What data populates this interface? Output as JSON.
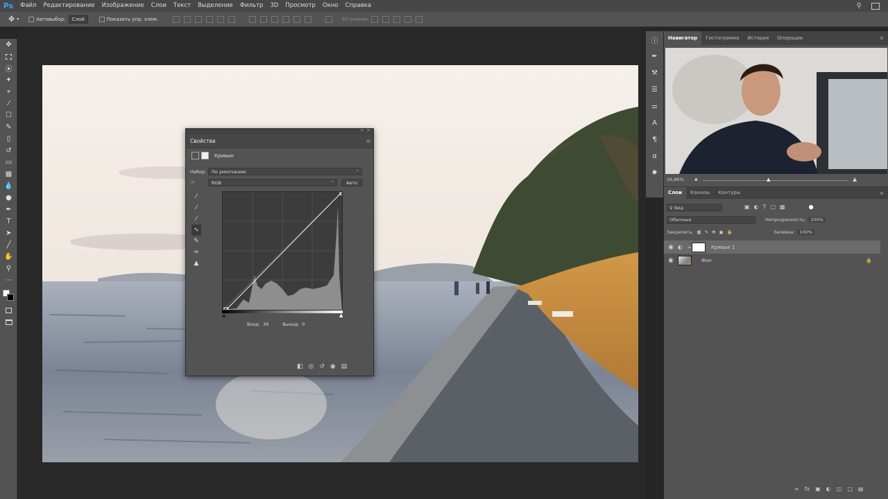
{
  "app": {
    "logo": "Ps"
  },
  "menu": [
    "Файл",
    "Редактирование",
    "Изображение",
    "Слои",
    "Текст",
    "Выделение",
    "Фильтр",
    "3D",
    "Просмотр",
    "Окно",
    "Справка"
  ],
  "options": {
    "autoselect_label": "Автовыбор:",
    "autoselect_value": "Слой",
    "show_transform_label": "Показать упр. элем.",
    "mode3d_label": "3D-режим:"
  },
  "tools": [
    "move-icon",
    "marquee-icon",
    "lasso-icon",
    "quick-select-icon",
    "crop-icon",
    "eyedropper-icon",
    "healing-icon",
    "brush-icon",
    "stamp-icon",
    "history-brush-icon",
    "eraser-icon",
    "gradient-icon",
    "blur-icon",
    "dodge-icon",
    "pen-icon",
    "type-icon",
    "path-select-icon",
    "shape-icon",
    "hand-icon",
    "zoom-icon",
    "more-icon"
  ],
  "properties": {
    "title": "Свойства",
    "adjustment_name": "Кривые",
    "preset_label": "Набор:",
    "preset_value": "По умолчанию",
    "channel_value": "RGB",
    "auto_label": "Авто",
    "input_label": "Вход:",
    "input_value": "39",
    "output_label": "Выход:",
    "output_value": "0"
  },
  "navigator": {
    "tabs": [
      "Навигатор",
      "Гистограмма",
      "История",
      "Операции"
    ],
    "zoom": "26,86%"
  },
  "layers_panel": {
    "tabs": [
      "Слои",
      "Каналы",
      "Контуры"
    ],
    "filter_label": "Вид",
    "blend_mode": "Обычные",
    "opacity_label": "Непрозрачность:",
    "opacity_value": "100%",
    "lock_label": "Закрепить:",
    "fill_label": "Заливка:",
    "fill_value": "100%",
    "layers": [
      {
        "name": "Кривые 1"
      },
      {
        "name": "Фон"
      }
    ]
  },
  "colors": {
    "accent": "#31a8ff",
    "panel": "#535353",
    "dark": "#282828"
  }
}
